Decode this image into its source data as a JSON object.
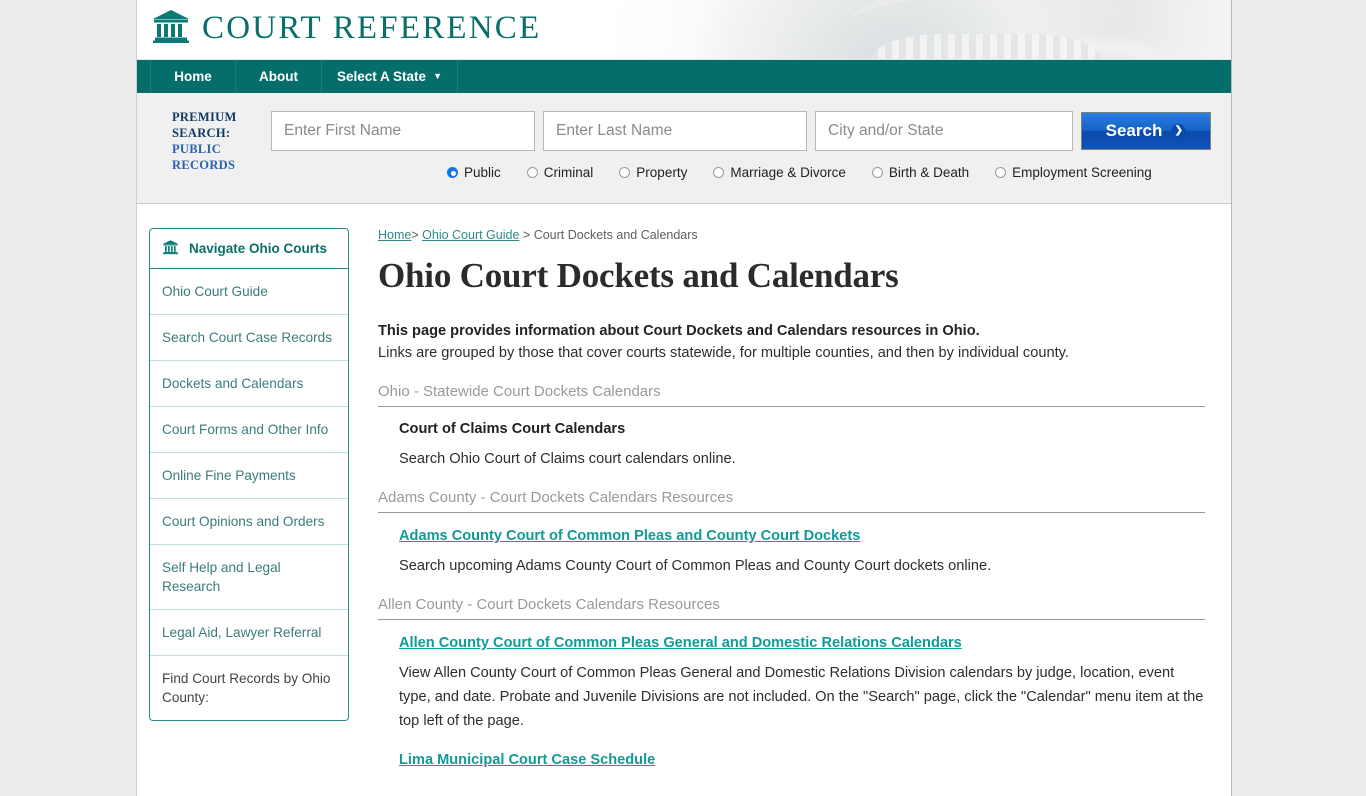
{
  "site": {
    "brand_title": "COURT REFERENCE",
    "logo_icon": "courthouse-icon"
  },
  "nav": {
    "items": [
      {
        "label": "Home"
      },
      {
        "label": "About"
      },
      {
        "label": "Select A State",
        "caret": "▼"
      }
    ]
  },
  "premium_search": {
    "label_line1": "PREMIUM",
    "label_line2": "SEARCH:",
    "link_line1": "PUBLIC",
    "link_line2": "RECORDS",
    "first_name_placeholder": "Enter First Name",
    "first_name_value": "",
    "last_name_placeholder": "Enter Last Name",
    "last_name_value": "",
    "city_state_placeholder": "City and/or State",
    "city_state_value": "",
    "search_button": "Search",
    "search_chevron": "❯",
    "radio_options": [
      {
        "label": "Public",
        "selected": true
      },
      {
        "label": "Criminal",
        "selected": false
      },
      {
        "label": "Property",
        "selected": false
      },
      {
        "label": "Marriage & Divorce",
        "selected": false
      },
      {
        "label": "Birth & Death",
        "selected": false
      },
      {
        "label": "Employment Screening",
        "selected": false
      }
    ],
    "button_color": "#1663c6"
  },
  "sidebar": {
    "header": "Navigate Ohio Courts",
    "header_icon": "courthouse-icon",
    "items": [
      {
        "label": "Ohio Court Guide",
        "link": true
      },
      {
        "label": "Search Court Case Records",
        "link": true
      },
      {
        "label": "Dockets and Calendars",
        "link": true
      },
      {
        "label": "Court Forms and Other Info",
        "link": true
      },
      {
        "label": "Online Fine Payments",
        "link": true
      },
      {
        "label": "Court Opinions and Orders",
        "link": true
      },
      {
        "label": "Self Help and Legal Research",
        "link": true
      },
      {
        "label": "Legal Aid, Lawyer Referral",
        "link": true
      },
      {
        "label": "Find Court Records by Ohio County:",
        "link": false
      }
    ],
    "accent_color": "#0a6f6b"
  },
  "main": {
    "breadcrumb": {
      "home": "Home",
      "guide": "Ohio Court Guide",
      "current": "Court Dockets and Calendars",
      "separator": ">"
    },
    "page_title": "Ohio Court Dockets and Calendars",
    "intro_bold": "This page provides information about Court Dockets and Calendars resources in Ohio.",
    "intro_plain": "Links are grouped by those that cover courts statewide, for multiple counties, and then by individual county.",
    "sections": [
      {
        "heading": "Ohio - Statewide Court Dockets Calendars",
        "entries": [
          {
            "title": "Court of Claims Court Calendars",
            "is_link": false,
            "description": "Search Ohio Court of Claims court calendars online."
          }
        ]
      },
      {
        "heading": "Adams County - Court Dockets Calendars Resources",
        "entries": [
          {
            "title": "Adams County Court of Common Pleas and County Court Dockets",
            "is_link": true,
            "description": "Search upcoming Adams County Court of Common Pleas and County Court dockets online."
          }
        ]
      },
      {
        "heading": "Allen County - Court Dockets Calendars Resources",
        "entries": [
          {
            "title": "Allen County Court of Common Pleas General and Domestic Relations Calendars",
            "is_link": true,
            "description": "View Allen County Court of Common Pleas General and Domestic Relations Division calendars by judge, location, event type, and date. Probate and Juvenile Divisions are not included. On the \"Search\" page, click the \"Calendar\" menu item at the top left of the page."
          },
          {
            "title": "Lima Municipal Court Case Schedule",
            "is_link": true,
            "description": ""
          }
        ]
      }
    ],
    "link_color": "#0f9b96"
  }
}
